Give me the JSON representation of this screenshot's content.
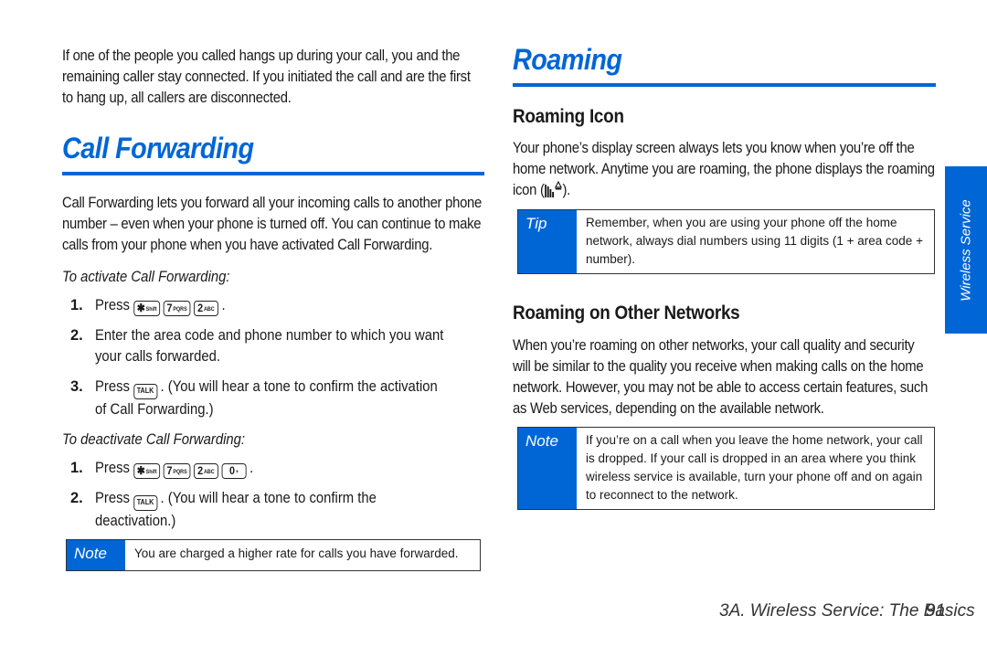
{
  "left": {
    "intro": "If one of the people you called hangs up during your call, you and the remaining caller stay connected. If you initiated the call and are the first to hang up, all callers are disconnected.",
    "section_title": "Call Forwarding",
    "section_body": "Call Forwarding lets you forward all your incoming calls to another phone number – even when your phone is turned off. You can continue to make calls from your phone when you have activated Call Forwarding.",
    "activate": {
      "heading": "To activate Call Forwarding:",
      "steps": [
        {
          "num": "1.",
          "prefix": "Press",
          "keys": [
            {
              "main": "✱",
              "sub": "Shift"
            },
            {
              "main": "7",
              "sub": "PQRS"
            },
            {
              "main": "2",
              "sub": "ABC"
            }
          ],
          "suffix": "."
        },
        {
          "num": "2.",
          "text": "Enter the area code and phone number to which you want your calls forwarded."
        },
        {
          "num": "3.",
          "prefix": "Press",
          "keys": [
            {
              "main": "TALK",
              "sub": ""
            }
          ],
          "suffix": ". (You will hear a tone to confirm the activation of Call Forwarding.)"
        }
      ]
    },
    "deactivate": {
      "heading": "To deactivate Call Forwarding:",
      "steps": [
        {
          "num": "1.",
          "prefix": "Press",
          "keys": [
            {
              "main": "✱",
              "sub": "Shift"
            },
            {
              "main": "7",
              "sub": "PQRS"
            },
            {
              "main": "2",
              "sub": "ABC"
            },
            {
              "main": "0",
              "sub": "+"
            }
          ],
          "suffix": "."
        },
        {
          "num": "2.",
          "prefix": "Press",
          "keys": [
            {
              "main": "TALK",
              "sub": ""
            }
          ],
          "suffix": ". (You will hear a tone to confirm the deactivation.)"
        }
      ]
    },
    "note": {
      "tag": "Note",
      "text": "You are charged a higher rate for calls you have forwarded."
    }
  },
  "right": {
    "section_title": "Roaming",
    "roaming_icon": {
      "heading": "Roaming Icon",
      "body_before": "Your phone’s display screen always lets you know when you’re off the home network. Anytime you are roaming, the phone displays the roaming icon (",
      "body_after": ")."
    },
    "tip": {
      "tag": "Tip",
      "text": "Remember, when you are using your phone off the home network, always dial numbers using 11 digits (1 + area code + number)."
    },
    "other_networks": {
      "heading": "Roaming on Other Networks",
      "body": "When you’re roaming on other networks, your call quality and security will be similar to the quality you receive when making calls on the home network. However, you may not be able to access certain features, such as Web services, depending on the available network."
    },
    "note": {
      "tag": "Note",
      "text": "If you’re on a call when you leave the home network, your call is dropped. If your call is dropped in an area where you think wireless service is available, turn your phone off and on again to reconnect to the network."
    }
  },
  "side_tab": "Wireless Service",
  "footer": {
    "section": "3A. Wireless Service: The Basics",
    "page": "91"
  },
  "colors": {
    "accent": "#0066d6"
  }
}
